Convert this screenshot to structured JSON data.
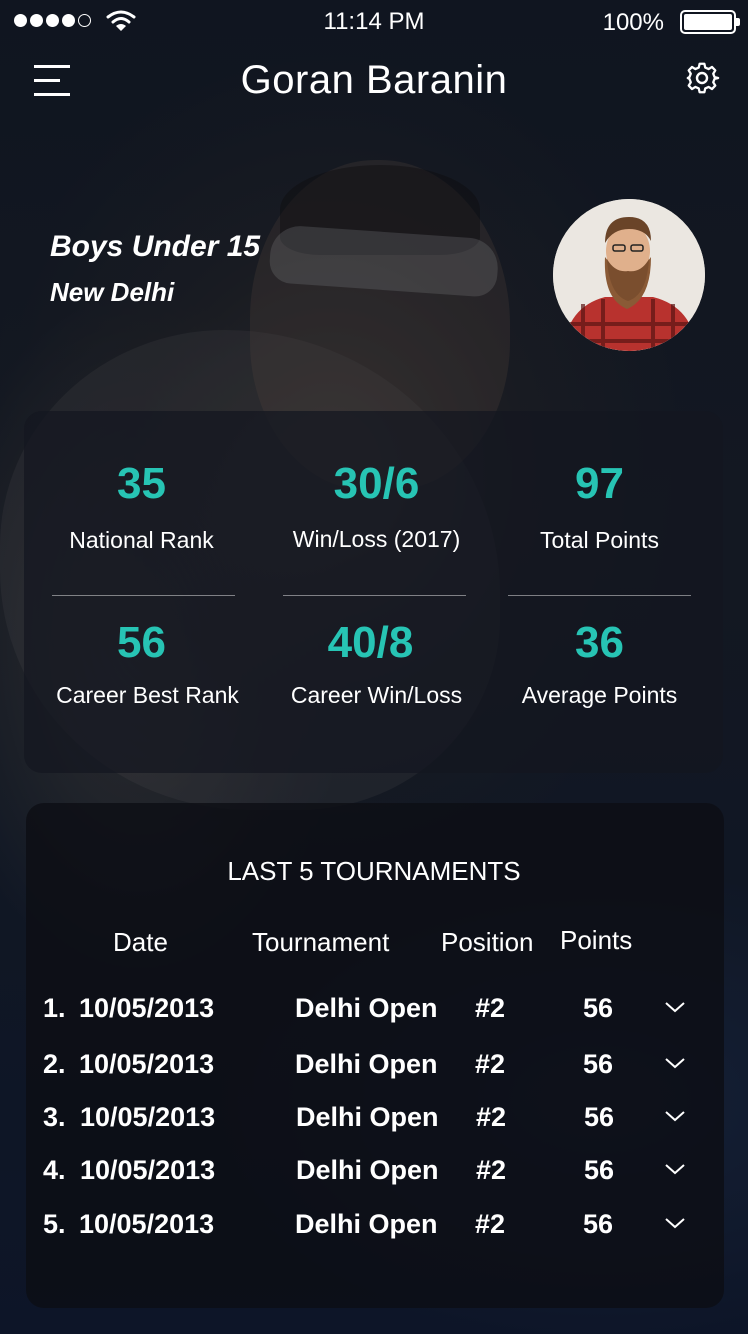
{
  "status_bar": {
    "time": "11:14 PM",
    "battery": "100%",
    "signal_dots_filled": 4,
    "signal_dots_total": 5
  },
  "header": {
    "title": "Goran Baranin",
    "menu_icon": "hamburger-menu-icon",
    "settings_icon": "gear-icon"
  },
  "profile": {
    "category": "Boys Under 15",
    "city": "New Delhi"
  },
  "stats": [
    {
      "value": "35",
      "label": "National Rank"
    },
    {
      "value": "30/6",
      "label": "Win/Loss (2017)"
    },
    {
      "value": "97",
      "label": "Total Points"
    },
    {
      "value": "56",
      "label": "Career Best Rank"
    },
    {
      "value": "40/8",
      "label": "Career Win/Loss"
    },
    {
      "value": "36",
      "label": "Average Points"
    }
  ],
  "tournaments": {
    "title": "LAST 5 TOURNAMENTS",
    "columns": {
      "date": "Date",
      "tournament": "Tournament",
      "position": "Position",
      "points": "Points"
    },
    "rows": [
      {
        "index": "1.",
        "date": "10/05/2013",
        "tournament": "Delhi Open",
        "position": "#2",
        "points": "56"
      },
      {
        "index": "2.",
        "date": "10/05/2013",
        "tournament": "Delhi Open",
        "position": "#2",
        "points": "56"
      },
      {
        "index": "3.",
        "date": "10/05/2013",
        "tournament": "Delhi Open",
        "position": "#2",
        "points": "56"
      },
      {
        "index": "4.",
        "date": "10/05/2013",
        "tournament": "Delhi Open",
        "position": "#2",
        "points": "56"
      },
      {
        "index": "5.",
        "date": "10/05/2013",
        "tournament": "Delhi Open",
        "position": "#2",
        "points": "56"
      }
    ]
  },
  "colors": {
    "accent": "#27c4b4"
  }
}
